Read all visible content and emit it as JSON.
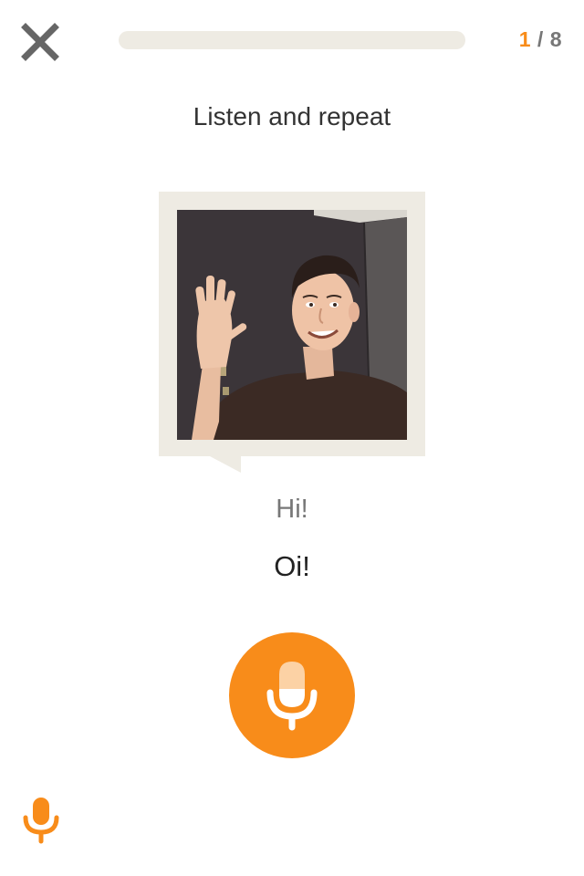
{
  "header": {
    "close_icon": "close-icon",
    "progress": {
      "current": "1",
      "separator": "/",
      "total": "8",
      "fraction_complete": 0
    }
  },
  "exercise": {
    "instruction": "Listen and repeat",
    "translation": "Hi!",
    "phrase": "Oi!",
    "image_icon": "waving-person-photo"
  },
  "controls": {
    "record_icon": "microphone-icon",
    "mic_toggle_icon": "microphone-icon"
  },
  "colors": {
    "accent": "#f88c1a",
    "accent_light": "#fcd2a5",
    "frame": "#eeebe3",
    "close": "#666666",
    "text_dark": "#222222",
    "text_muted": "#777777"
  }
}
